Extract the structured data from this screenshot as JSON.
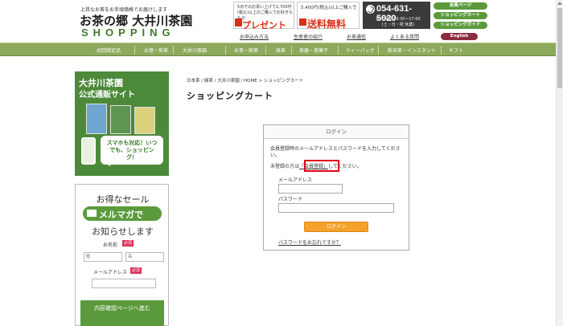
{
  "header": {
    "tagline": "上質なお茶をお手頃価格でお届けします",
    "logo_main": "お茶の郷 大井川茶園",
    "logo_sub": "SHOPPING",
    "promo_gift_small": "5点でのお買い上げで2,700円(税込)以上のご購入でお好きなもの",
    "promo_gift_big": "プレゼント",
    "promo_ship_small": "5,400円(税込)以上ご購入で",
    "promo_ship_big": "送料無料",
    "phone_number": "054-631-5020",
    "phone_hours": "受付時間 / 9:30～17:00 (土・日・祝 休業)",
    "member_page": "会員ページ",
    "shopping_cart": "ショッピングカート",
    "shopping_guide": "ショッピングガイド",
    "english": "English",
    "subnav": [
      "お申込み方法",
      "生産者の紹介",
      "お茶通信",
      "よくある質問"
    ]
  },
  "mainnav": [
    "初回限定品",
    "お徳・煎茶",
    "大井川茶園",
    "お茶・煎茶",
    "抹茶",
    "茶器・茶菓子",
    "ティーバッグ",
    "粉末茶・インスタント",
    "ギフト"
  ],
  "sidebar": {
    "banner_title1": "大井川茶園",
    "banner_title2": "公式通販サイト",
    "banner_bubble": "スマホも対応！いつでも、ショッピング！",
    "news_h1": "お得なセール",
    "news_mail": "メルマガで",
    "news_h2": "お知らせします",
    "name_label": "お名前",
    "required": "必須",
    "last_name_placeholder": "姓",
    "first_name_placeholder": "名",
    "email_label": "メールアドレス",
    "confirm_button": "内容確認ページへ進む"
  },
  "breadcrumb": "日本茶 / 緑茶 / 大井川茶園 / HOME > ショッピングカート",
  "page_title": "ショッピングカート",
  "login": {
    "heading": "ログイン",
    "desc": "会員登録時のメールアドレスとパスワードを入力してください。",
    "desc2_pre": "未登録の方は",
    "register_link": "「会員登録」",
    "desc2_post": "してください。",
    "email_label": "メールアドレス",
    "password_label": "パスワード",
    "login_button": "ログイン",
    "forgot_link": "パスワードをお忘れですか？"
  }
}
